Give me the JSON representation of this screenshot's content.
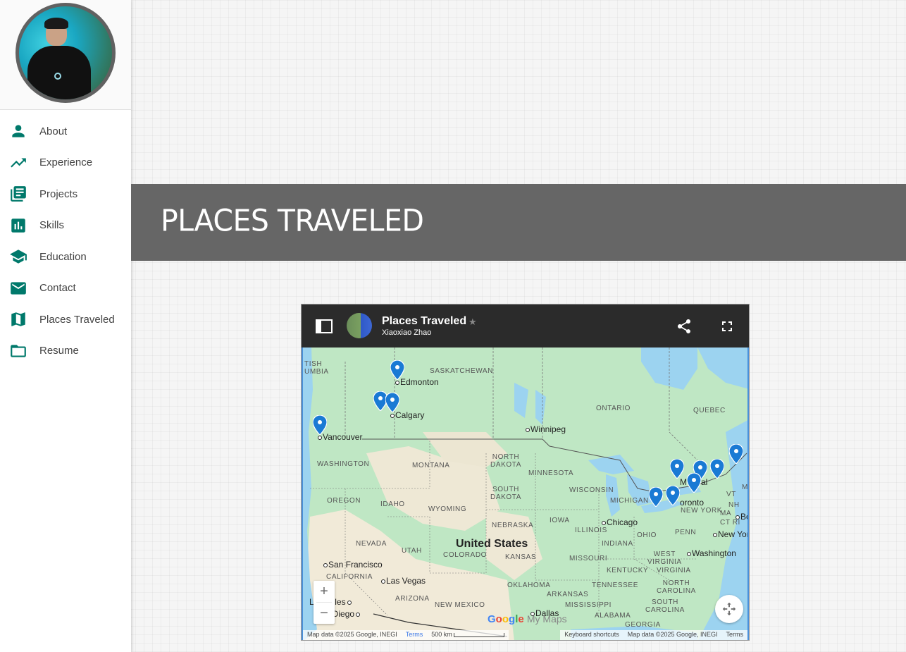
{
  "sidebar": {
    "items": [
      {
        "label": "About",
        "icon": "person-icon"
      },
      {
        "label": "Experience",
        "icon": "trending-up-icon"
      },
      {
        "label": "Projects",
        "icon": "library-books-icon"
      },
      {
        "label": "Skills",
        "icon": "bar-chart-icon"
      },
      {
        "label": "Education",
        "icon": "school-icon"
      },
      {
        "label": "Contact",
        "icon": "mail-icon"
      },
      {
        "label": "Places Traveled",
        "icon": "map-icon"
      },
      {
        "label": "Resume",
        "icon": "folder-icon"
      }
    ]
  },
  "section": {
    "title": "PLACES TRAVELED"
  },
  "map": {
    "title": "Places Traveled",
    "author": "Xiaoxiao Zhao",
    "star": "★",
    "regions": {
      "british_columbia": "TISH\nUMBIA",
      "saskatchewan": "SASKATCHEWAN",
      "ontario": "ONTARIO",
      "quebec": "QUEBEC",
      "washington": "WASHINGTON",
      "montana": "MONTANA",
      "north_dakota": "NORTH\nDAKOTA",
      "minnesota": "MINNESOTA",
      "south_dakota": "SOUTH\nDAKOTA",
      "wisconsin": "WISCONSIN",
      "michigan": "MICHIGAN",
      "oregon": "OREGON",
      "idaho": "IDAHO",
      "wyoming": "WYOMING",
      "nebraska": "NEBRASKA",
      "iowa": "IOWA",
      "illinois": "ILLINOIS",
      "indiana": "INDIANA",
      "ohio": "OHIO",
      "penn": "PENN",
      "new_york": "NEW YORK",
      "vt": "VT",
      "ma": "MA",
      "ma2": "MA",
      "nh": "NH",
      "ct_ri": "CT RI",
      "nevada": "NEVADA",
      "utah": "UTAH",
      "colorado": "COLORADO",
      "kansas": "KANSAS",
      "missouri": "MISSOURI",
      "kentucky": "KENTUCKY",
      "west_virginia": "WEST\nVIRGINIA",
      "virginia": "VIRGINIA",
      "california": "CALIFORNIA",
      "arizona": "ARIZONA",
      "new_mexico": "NEW MEXICO",
      "oklahoma": "OKLAHOMA",
      "arkansas": "ARKANSAS",
      "tennessee": "TENNESSEE",
      "north_carolina": "NORTH\nCAROLINA",
      "south_carolina": "SOUTH\nCAROLINA",
      "mississippi": "MISSISSIPPI",
      "alabama": "ALABAMA",
      "georgia": "GEORGIA"
    },
    "country": "United States",
    "cities": {
      "edmonton": "Edmonton",
      "calgary": "Calgary",
      "vancouver": "Vancouver",
      "winnipeg": "Winnipeg",
      "chicago": "Chicago",
      "toronto": "oronto",
      "montreal": "M    eal",
      "boston": "Bo",
      "new_york": "New Yor",
      "washington": "Washington",
      "san_francisco": "San Francisco",
      "las_vegas": "Las Vegas",
      "los_angeles": "L     geles",
      "san_diego": "an Diego",
      "dallas": "Dallas"
    },
    "zoom_in": "+",
    "zoom_out": "−",
    "logo_google": "Google",
    "logo_mymaps": "My Maps",
    "attribution_left": "Map data ©2025 Google, INEGI",
    "terms_left": "Terms",
    "scale": "500 km",
    "keyboard": "Keyboard shortcuts",
    "attribution_right": "Map data ©2025 Google, INEGI",
    "terms_right": "Terms",
    "pin_color": "#1a7ad4"
  }
}
